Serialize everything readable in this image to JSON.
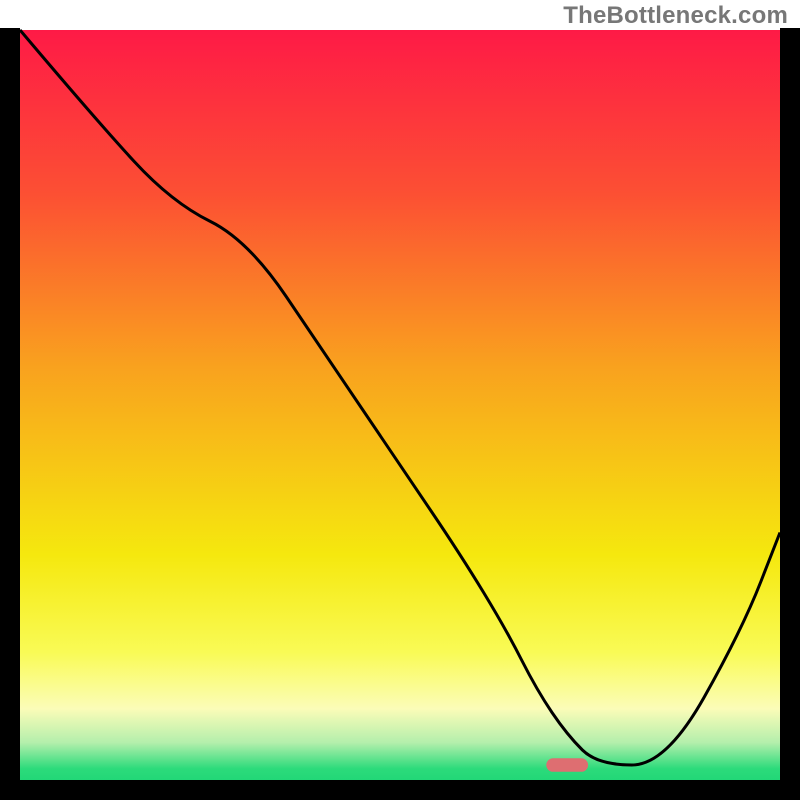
{
  "watermark": {
    "text": "TheBottleneck.com"
  },
  "chart_data": {
    "type": "line",
    "title": "",
    "xlabel": "",
    "ylabel": "",
    "xlim": [
      0,
      100
    ],
    "ylim": [
      0,
      100
    ],
    "grid": false,
    "legend": false,
    "background_gradient_stops": [
      {
        "pos": 0.0,
        "color": "#fe1a46"
      },
      {
        "pos": 0.22,
        "color": "#fc5033"
      },
      {
        "pos": 0.45,
        "color": "#f9a21e"
      },
      {
        "pos": 0.7,
        "color": "#f5e80e"
      },
      {
        "pos": 0.83,
        "color": "#f9fb56"
      },
      {
        "pos": 0.905,
        "color": "#fbfcb8"
      },
      {
        "pos": 0.95,
        "color": "#b4efac"
      },
      {
        "pos": 0.985,
        "color": "#2cdb7b"
      },
      {
        "pos": 1.0,
        "color": "#22d777"
      }
    ],
    "series": [
      {
        "name": "bottleneck-curve",
        "x": [
          0,
          10,
          20,
          30,
          40,
          50,
          58,
          64,
          68,
          72,
          76,
          85,
          95,
          100
        ],
        "y": [
          100,
          88,
          77,
          72,
          57,
          42,
          30,
          20,
          12,
          6,
          2,
          2,
          20,
          33
        ]
      }
    ],
    "marker": {
      "name": "target-marker",
      "x": 72,
      "y": 2,
      "color": "#de6e71",
      "width_pct": 5.5,
      "height_pct": 1.8
    },
    "frame": {
      "color": "#000000",
      "thickness": 20
    }
  }
}
